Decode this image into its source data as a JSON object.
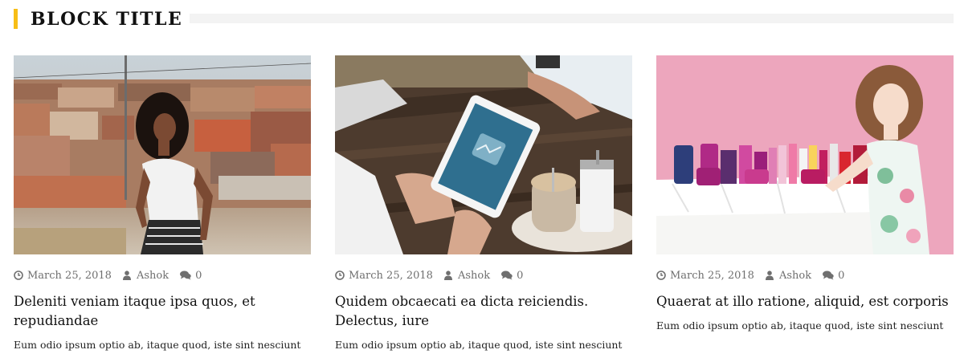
{
  "block": {
    "title": "BLOCK TITLE",
    "accent_color": "#f7be16",
    "line_color": "#f3f3f3"
  },
  "posts": [
    {
      "image_icon": "photo-woman-city-icon",
      "date": "March 25, 2018",
      "author": "Ashok",
      "comments": "0",
      "title": "Deleniti veniam itaque ipsa quos, et repudiandae",
      "excerpt": "Eum odio ipsum optio ab, itaque quod, iste sint nesciunt"
    },
    {
      "image_icon": "photo-tablet-coffee-icon",
      "date": "March 25, 2018",
      "author": "Ashok",
      "comments": "0",
      "title": "Quidem obcaecati ea dicta reiciendis. Delectus, iure",
      "excerpt": "Eum odio ipsum optio ab, itaque quod, iste sint nesciunt"
    },
    {
      "image_icon": "photo-cosmetics-icon",
      "date": "March 25, 2018",
      "author": "Ashok",
      "comments": "0",
      "title": "Quaerat at illo ratione, aliquid, est corporis",
      "excerpt": "Eum odio ipsum optio ab, itaque quod, iste sint nesciunt"
    }
  ],
  "icons": {
    "date": "clock-icon",
    "author": "user-icon",
    "comments": "comments-icon"
  }
}
